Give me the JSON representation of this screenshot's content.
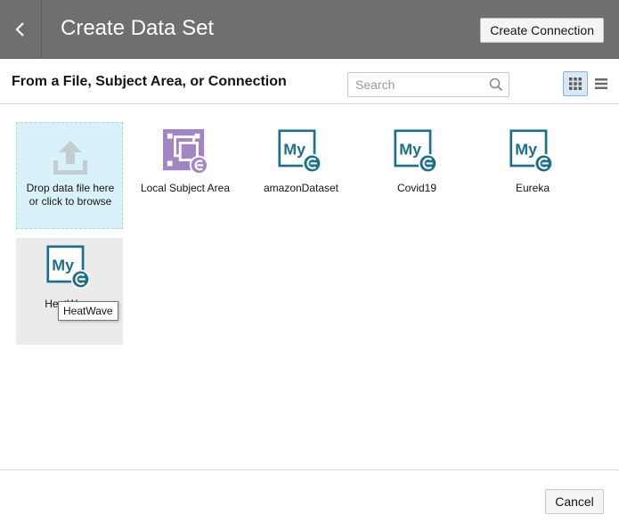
{
  "header": {
    "title": "Create Data Set",
    "create_connection_label": "Create Connection"
  },
  "subheader": {
    "title": "From a File, Subject Area, or Connection",
    "search_placeholder": "Search",
    "view_mode": "grid"
  },
  "tiles": {
    "drop": {
      "label": "Drop data file here or click to browse",
      "icon": "upload-icon"
    },
    "items": [
      {
        "label": "Local Subject Area",
        "icon": "subject-area-icon"
      },
      {
        "label": "amazonDataset",
        "icon": "mysql-connection-icon"
      },
      {
        "label": "Covid19",
        "icon": "mysql-connection-icon"
      },
      {
        "label": "Eureka",
        "icon": "mysql-connection-icon"
      },
      {
        "label": "HeatWave",
        "icon": "mysql-connection-icon"
      }
    ]
  },
  "tooltip": {
    "text": "HeatWave"
  },
  "footer": {
    "cancel_label": "Cancel"
  },
  "colors": {
    "header_bg": "#6f6f6f",
    "drop_zone_bg": "#d9f2fa",
    "mysql_teal": "#1f6f86",
    "subject_area_purple": "#a285c4"
  }
}
